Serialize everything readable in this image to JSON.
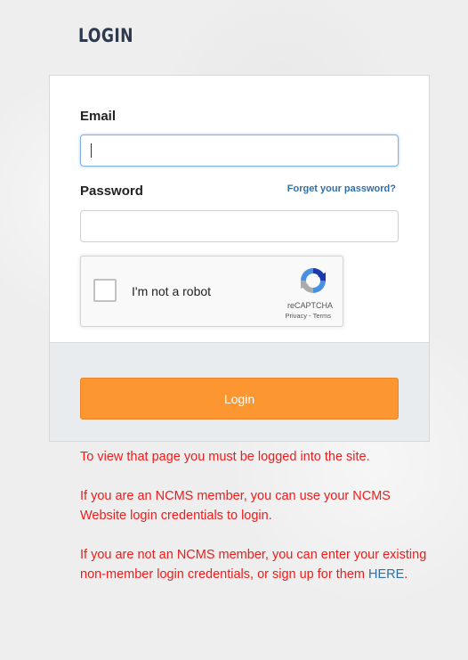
{
  "page": {
    "title": "LOGIN"
  },
  "form": {
    "email_label": "Email",
    "email_value": "",
    "password_label": "Password",
    "password_value": "",
    "forgot_link": "Forget your password?",
    "login_button": "Login"
  },
  "recaptcha": {
    "label": "I'm not a robot",
    "brand": "reCAPTCHA",
    "privacy": "Privacy",
    "separator": " - ",
    "terms": "Terms",
    "checked": false
  },
  "messages": {
    "line1": "To view that page you must be logged into the site.",
    "line2": "If you are an NCMS member, you can use your NCMS Website login credentials to login.",
    "line3_prefix": "If you are not an NCMS member, you can enter your existing non-member login credentials, or sign up for them ",
    "line3_link": "HERE",
    "line3_suffix": "."
  },
  "colors": {
    "accent": "#fb9631",
    "link": "#2f6fa8",
    "error_text": "#ee1c1c",
    "title": "#2d3a4e"
  },
  "icons": {
    "recaptcha_logo": "recaptcha-logo-icon"
  }
}
